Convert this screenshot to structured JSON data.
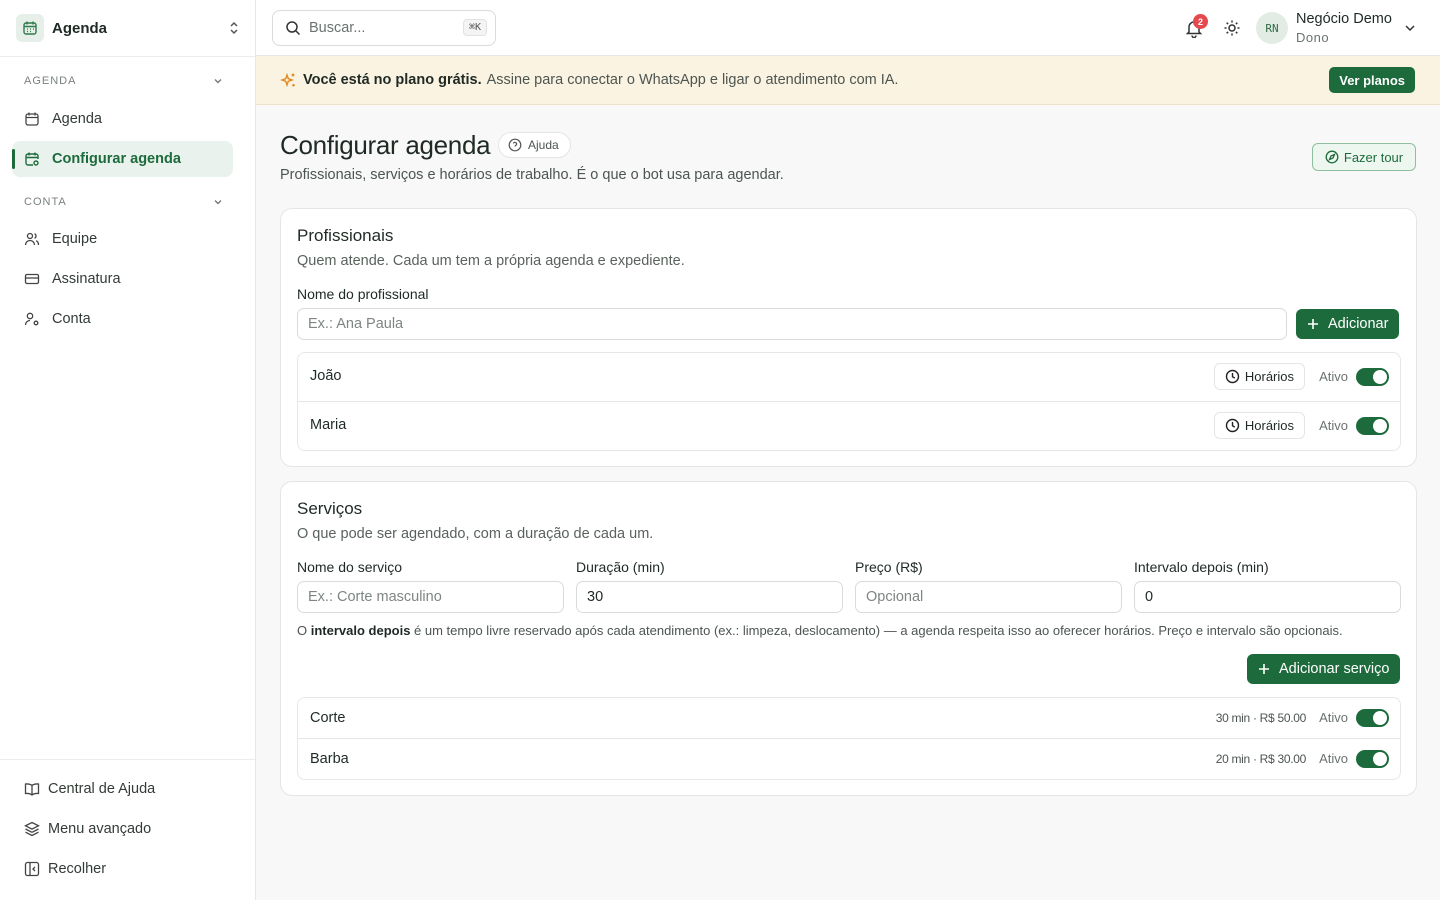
{
  "workspace": {
    "name": "Agenda"
  },
  "sidebar": {
    "groups": [
      {
        "label": "AGENDA",
        "items": [
          {
            "label": "Agenda"
          },
          {
            "label": "Configurar agenda"
          }
        ]
      },
      {
        "label": "CONTA",
        "items": [
          {
            "label": "Equipe"
          },
          {
            "label": "Assinatura"
          },
          {
            "label": "Conta"
          }
        ]
      }
    ],
    "footer": [
      {
        "label": "Central de Ajuda"
      },
      {
        "label": "Menu avançado"
      },
      {
        "label": "Recolher"
      }
    ]
  },
  "topbar": {
    "search_placeholder": "Buscar...",
    "search_shortcut": "⌘K",
    "notifications_count": "2",
    "user": {
      "initials": "RN",
      "name": "Negócio Demo",
      "role": "Dono"
    }
  },
  "banner": {
    "strong": "Você está no plano grátis.",
    "text": "Assine para conectar o WhatsApp e ligar o atendimento com IA.",
    "button": "Ver planos"
  },
  "page": {
    "title": "Configurar agenda",
    "help_label": "Ajuda",
    "subtitle": "Profissionais, serviços e horários de trabalho. É o que o bot usa para agendar.",
    "tour_label": "Fazer tour"
  },
  "professionals": {
    "title": "Profissionais",
    "subtitle": "Quem atende. Cada um tem a própria agenda e expediente.",
    "field_label": "Nome do profissional",
    "placeholder": "Ex.: Ana Paula",
    "add_label": "Adicionar",
    "items": [
      {
        "name": "João",
        "hours_label": "Horários",
        "status": "Ativo",
        "active": true
      },
      {
        "name": "Maria",
        "hours_label": "Horários",
        "status": "Ativo",
        "active": true
      }
    ]
  },
  "services": {
    "title": "Serviços",
    "subtitle": "O que pode ser agendado, com a duração de cada um.",
    "fields": {
      "name": {
        "label": "Nome do serviço",
        "placeholder": "Ex.: Corte masculino"
      },
      "duration": {
        "label": "Duração (min)",
        "value": "30"
      },
      "price": {
        "label": "Preço (R$)",
        "placeholder": "Opcional"
      },
      "interval": {
        "label": "Intervalo depois (min)",
        "value": "0"
      }
    },
    "hint_prefix": "O ",
    "hint_bold": "intervalo depois",
    "hint_rest": " é um tempo livre reservado após cada atendimento (ex.: limpeza, deslocamento) — a agenda respeita isso ao oferecer horários. Preço e intervalo são opcionais.",
    "add_label": "Adicionar serviço",
    "items": [
      {
        "name": "Corte",
        "meta": "30 min · R$ 50.00",
        "status": "Ativo",
        "active": true
      },
      {
        "name": "Barba",
        "meta": "20 min · R$ 30.00",
        "status": "Ativo",
        "active": true
      }
    ]
  },
  "colors": {
    "primary": "#1d6b3c",
    "banner_bg": "#fbf3e2",
    "badge": "#e5484d"
  }
}
